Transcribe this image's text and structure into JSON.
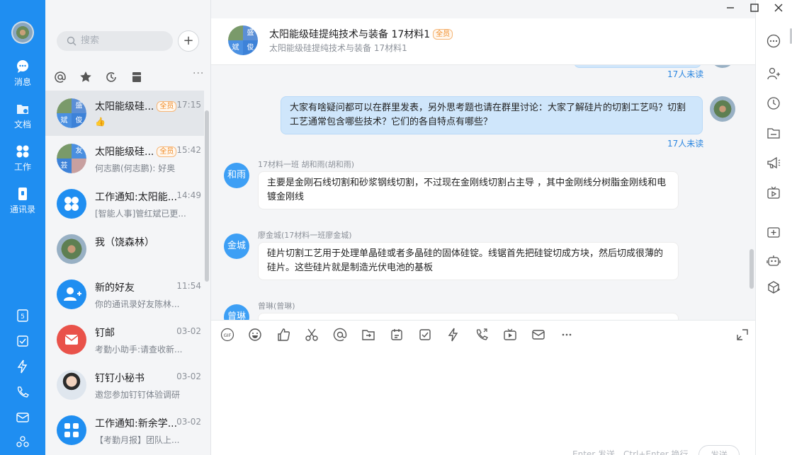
{
  "window_controls": {
    "minimize": "minimize-icon",
    "maximize": "maximize-icon",
    "close": "close-icon"
  },
  "nav": {
    "items": [
      {
        "label": "消息",
        "icon": "chat-bubble-icon"
      },
      {
        "label": "文档",
        "icon": "folder-icon"
      },
      {
        "label": "工作",
        "icon": "grid-icon"
      },
      {
        "label": "通讯录",
        "icon": "contacts-icon"
      }
    ],
    "bottom_icons": [
      "calendar-icon",
      "todo-icon",
      "flash-icon",
      "call-icon",
      "mail-icon",
      "more-apps-icon"
    ]
  },
  "search": {
    "placeholder": "搜索"
  },
  "add_label": "+",
  "filters": [
    "at-icon",
    "star-icon",
    "clock-icon",
    "archive-icon"
  ],
  "filters_more": "···",
  "conversations": [
    {
      "title": "太阳能级硅...",
      "tag": "全员",
      "time": "17:15",
      "sub": "👍",
      "avatar": {
        "cells": [
          "",
          "盛",
          "斌",
          "俊"
        ]
      }
    },
    {
      "title": "太阳能级硅...",
      "tag": "全员",
      "time": "15:42",
      "sub": "何志鹏(何志鹏): 好奥",
      "avatar": {
        "cells": [
          "",
          "友",
          "芸",
          ""
        ]
      }
    },
    {
      "title": "工作通知:太阳能...",
      "tag": "",
      "time": "14:49",
      "sub": "[智能人事]管红斌已更...",
      "avatar": {
        "icon": "app-grid-icon"
      }
    },
    {
      "title": "我（饶森林）",
      "tag": "",
      "time": "",
      "sub": "",
      "avatar": {
        "icon": "plant-photo"
      }
    },
    {
      "title": "新的好友",
      "tag": "",
      "time": "11:54",
      "sub": "你的通讯录好友陈林...",
      "avatar": {
        "icon": "add-friend-icon"
      }
    },
    {
      "title": "钉邮",
      "tag": "",
      "time": "03-02",
      "sub": "考勤小助手:请查收新...",
      "avatar": {
        "icon": "mail-icon"
      }
    },
    {
      "title": "钉钉小秘书",
      "tag": "",
      "time": "03-02",
      "sub": "邀您参加钉钉体验调研",
      "avatar": {
        "icon": "person-photo"
      }
    },
    {
      "title": "工作通知:新余学...",
      "tag": "",
      "time": "03-02",
      "sub": "【考勤月报】团队上...",
      "avatar": {
        "icon": "app-grid-icon"
      }
    }
  ],
  "chat": {
    "title": "太阳能级硅提纯技术与装备 17材料1",
    "tag": "全员",
    "subtitle": "太阳能级硅提纯技术与装备 17材料1",
    "header_avatar": [
      "",
      "盛",
      "斌",
      "俊"
    ],
    "messages": [
      {
        "type": "read",
        "text": "17人未读"
      },
      {
        "type": "me",
        "text": "大家有啥疑问都可以在群里发表，另外思考题也请在群里讨论：大家了解硅片的切割工艺吗？切割工艺通常包含哪些技术？它们的各自特点有哪些？",
        "read": "17人未读"
      },
      {
        "type": "other",
        "avatar": "和雨",
        "name": "17材料一班 胡和雨(胡和雨)",
        "text": "主要是金刚石线切割和砂浆钢线切割，不过现在金刚线切割占主导 ，其中金刚线分树脂金刚线和电镀金刚线"
      },
      {
        "type": "other",
        "avatar": "金城",
        "name": "廖金城(17材料一班廖金城)",
        "text": "硅片切割工艺用于处理单晶硅或者多晶硅的固体硅锭。线锯首先把硅锭切成方块，然后切成很薄的硅片。这些硅片就是制造光伏电池的基板"
      },
      {
        "type": "other",
        "avatar": "曾琳",
        "name": "曾琳(曾琳)",
        "text": ""
      }
    ]
  },
  "composer": {
    "tools": [
      "gif-icon",
      "emoji-icon",
      "thumbs-up-icon",
      "scissors-icon",
      "at-icon",
      "folder-send-icon",
      "calendar-icon",
      "todo-icon",
      "flash-icon",
      "phone-icon",
      "video-icon",
      "mail-icon",
      "more-icon"
    ],
    "expand": "expand-icon",
    "hint": "Enter 发送，Ctrl+Enter 换行",
    "send": "发送"
  },
  "right_bar": [
    "more-circle-icon",
    "add-member-icon",
    "history-icon",
    "files-icon",
    "announcement-icon",
    "live-icon",
    "add-app-icon",
    "robot-icon",
    "plugin-icon"
  ]
}
